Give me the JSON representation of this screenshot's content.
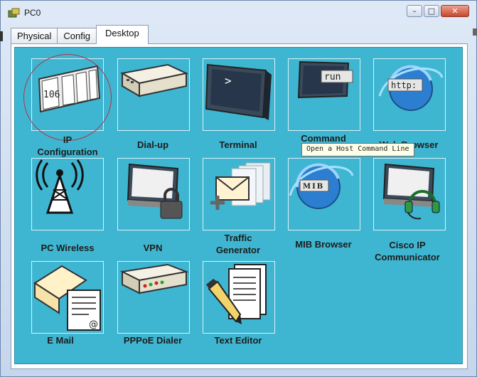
{
  "window": {
    "title": "PC0",
    "minimize_glyph": "–",
    "maximize_glyph": "□",
    "close_glyph": "✕"
  },
  "tabs": [
    {
      "label": "Physical",
      "active": false
    },
    {
      "label": "Config",
      "active": false
    },
    {
      "label": "Desktop",
      "active": true
    }
  ],
  "desktop": {
    "background_color": "#3fb6d1",
    "apps": [
      {
        "label_line1": "IP",
        "label_line2": "Configuration",
        "icon": "ip-configuration-icon",
        "icon_text": "106"
      },
      {
        "label_line1": "Dial-up",
        "label_line2": "",
        "icon": "modem-icon"
      },
      {
        "label_line1": "Terminal",
        "label_line2": "",
        "icon": "terminal-icon",
        "icon_text": ">"
      },
      {
        "label_line1": "Command",
        "label_line2": "",
        "icon": "command-prompt-icon",
        "icon_text": "run"
      },
      {
        "label_line1": "Web Browser",
        "label_line2": "",
        "icon": "web-browser-icon",
        "icon_text": "http:"
      },
      {
        "label_line1": "PC Wireless",
        "label_line2": "",
        "icon": "wireless-tower-icon"
      },
      {
        "label_line1": "VPN",
        "label_line2": "",
        "icon": "vpn-lock-icon"
      },
      {
        "label_line1": "Traffic",
        "label_line2": "Generator",
        "icon": "traffic-generator-icon"
      },
      {
        "label_line1": "MIB Browser",
        "label_line2": "",
        "icon": "mib-browser-icon",
        "icon_text": "MIB"
      },
      {
        "label_line1": "Cisco IP",
        "label_line2": "Communicator",
        "icon": "ip-communicator-icon"
      },
      {
        "label_line1": "E Mail",
        "label_line2": "",
        "icon": "email-icon",
        "icon_text": "@"
      },
      {
        "label_line1": "PPPoE Dialer",
        "label_line2": "",
        "icon": "pppoe-dialer-icon"
      },
      {
        "label_line1": "Text Editor",
        "label_line2": "",
        "icon": "text-editor-icon"
      }
    ]
  },
  "tooltip": {
    "text": "Open a Host Command Line"
  }
}
